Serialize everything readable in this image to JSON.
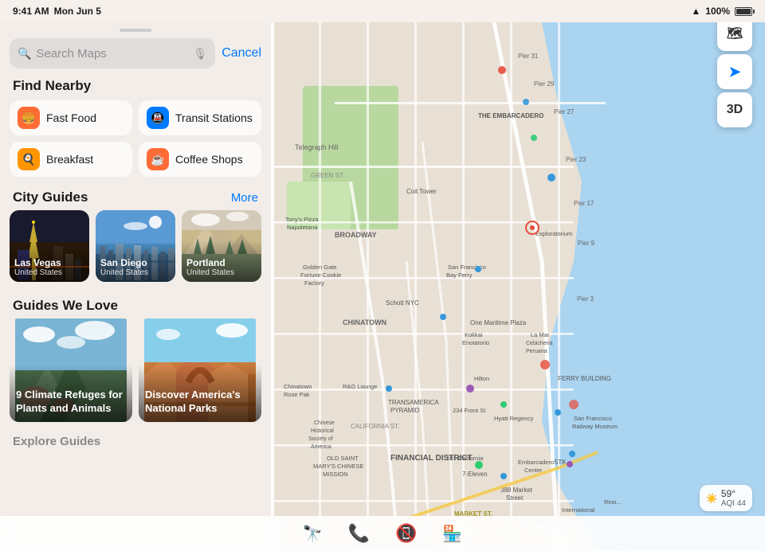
{
  "statusBar": {
    "time": "9:41 AM",
    "day": "Mon Jun 5",
    "wifi": "WiFi",
    "battery": "100%"
  },
  "searchBar": {
    "placeholder": "Search Maps",
    "cancelLabel": "Cancel"
  },
  "findNearby": {
    "sectionLabel": "Find Nearby",
    "items": [
      {
        "id": "fast-food",
        "label": "Fast Food",
        "icon": "🍔",
        "color": "#FF6B35"
      },
      {
        "id": "transit",
        "label": "Transit Stations",
        "icon": "🚇",
        "color": "#007AFF"
      },
      {
        "id": "breakfast",
        "label": "Breakfast",
        "icon": "🍳",
        "color": "#FF9500"
      },
      {
        "id": "coffee",
        "label": "Coffee Shops",
        "icon": "☕",
        "color": "#FF6B35"
      }
    ]
  },
  "cityGuides": {
    "sectionLabel": "City Guides",
    "moreLabel": "More",
    "cities": [
      {
        "name": "Las Vegas",
        "country": "United States",
        "bgColor": "#c4a832"
      },
      {
        "name": "San Diego",
        "country": "United States",
        "bgColor": "#4a7fa5"
      },
      {
        "name": "Portland",
        "country": "United States",
        "bgColor": "#8a9a6a"
      }
    ]
  },
  "guidesWeLove": {
    "sectionLabel": "Guides We Love",
    "guides": [
      {
        "title": "9 Climate Refuges for Plants and Animals",
        "bgColor1": "#5a7a5a",
        "bgColor2": "#3a5a3a"
      },
      {
        "title": "Discover America's National Parks",
        "bgColor1": "#c87a3a",
        "bgColor2": "#a05a20"
      }
    ]
  },
  "exploreLabel": "Explore Guides",
  "mapControls": [
    {
      "id": "map-view",
      "label": "🗺"
    },
    {
      "id": "location",
      "label": "➤"
    },
    {
      "id": "3d",
      "label": "3D"
    }
  ],
  "weather": {
    "temp": "59°",
    "aqi": "AQI 44",
    "icon": "☀️"
  },
  "map": {
    "labels": [
      "Telegraph Hill",
      "THE EMBARCADERO",
      "BROADWAY",
      "CHINATOWN",
      "FINANCIAL DISTRICT",
      "Pier 31",
      "Pier 29",
      "Pier 27",
      "Pier 23",
      "Pier 17",
      "Pier 9",
      "Pier 3",
      "Coit Tower",
      "TRANSAMERICA PYRAMID",
      "Golden Gate Fortune Cookie Factory"
    ]
  },
  "bottomBar": {
    "binocularsIcon": "🔭",
    "phoneIcon": "📞",
    "phoneRedIcon": "📵",
    "storeIcon": "🏪"
  }
}
